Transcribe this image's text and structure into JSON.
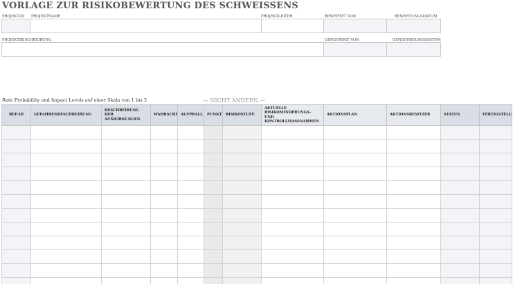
{
  "title": "VORLAGE ZUR RISIKOBEWERTUNG DES SCHWEISSENS",
  "header_fields": {
    "project_id": "PROJEKT-ID",
    "project_name": "PROJEKTNAME",
    "project_lead": "PROJEKTLEITER",
    "assessed_by": "BEWERTET VON",
    "assessment_date": "BEWERTUNGSDATUM",
    "project_description": "PROJEKTBESCHREIBUNG",
    "approved_by": "GENEHMIGT VON",
    "approval_date": "GENEHMIGUNGSDATUM"
  },
  "scale_note": "Rate Probability and Impact Levels auf einer Skala von 1 bis 3",
  "do_not_change": "— NICHT ÄNDERN —",
  "table": {
    "columns": [
      "REF-ID",
      "GEFAHRENBESCHREIBUNG",
      "BESCHREIBUNG DER AUSWIRKUNGEN",
      "WAHRSCHEINLICHKEIT",
      "AUFPRALL",
      "PUNKTZAHL",
      "RISIKOSTUFE",
      "AKTUELLE RISIKOMINDERUNGS- UND KONTROLLMASSNAHMEN",
      "AKTIONSPLAN",
      "AKTIONSBESITZER",
      "STATUS",
      "FERTIGSTELLUNGSDATUM"
    ],
    "row_count": 12
  }
}
